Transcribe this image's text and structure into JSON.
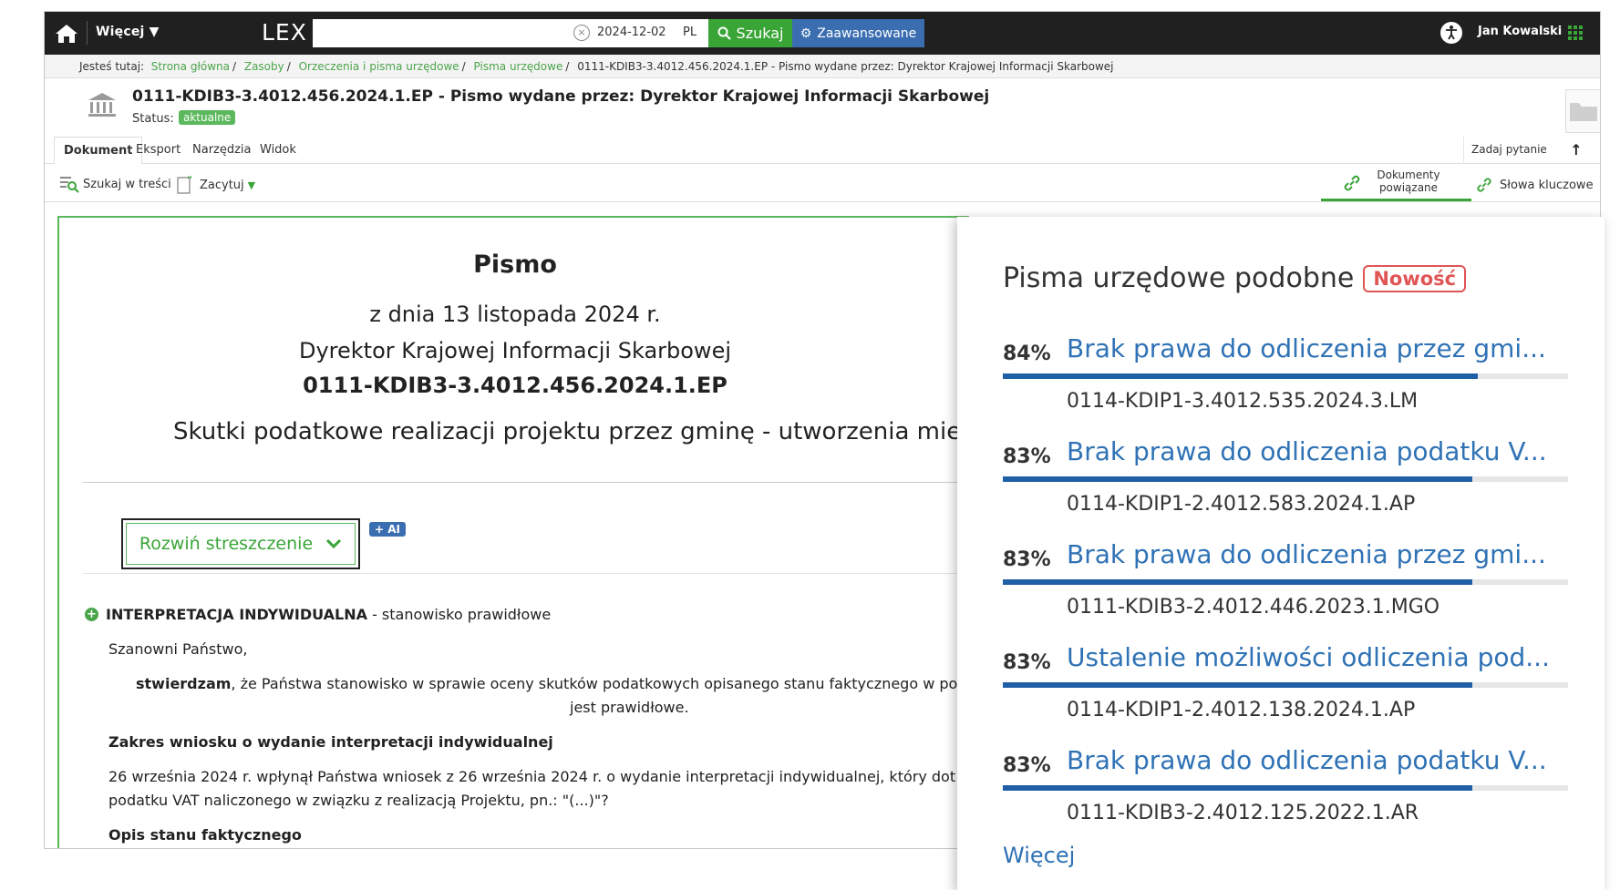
{
  "topbar": {
    "more_label": "Więcej",
    "logo": "LEX",
    "search_placeholder": "",
    "date": "2024-12-02",
    "lang": "PL",
    "search_label": "Szukaj",
    "advanced_label": "Zaawansowane",
    "user_name": "Jan Kowalski"
  },
  "breadcrumb": {
    "prefix": "Jesteś tutaj:",
    "items": [
      "Strona główna",
      "Zasoby",
      "Orzeczenia i pisma urzędowe",
      "Pisma urzędowe"
    ],
    "current": "0111-KDIB3-3.4012.456.2024.1.EP - Pismo wydane przez: Dyrektor Krajowej Informacji Skarbowej"
  },
  "document_header": {
    "title": "0111-KDIB3-3.4012.456.2024.1.EP - Pismo wydane przez: Dyrektor Krajowej Informacji Skarbowej",
    "status_label": "Status:",
    "status_value": "aktualne"
  },
  "tabs": [
    {
      "label": "Dokument",
      "active": true
    },
    {
      "label": "Eksport",
      "active": false
    },
    {
      "label": "Narzędzia",
      "active": false
    },
    {
      "label": "Widok",
      "active": false
    }
  ],
  "tabbar_right": {
    "ask_label": "Zadaj pytanie",
    "up_icon": "arrow-up-icon"
  },
  "toolbar": {
    "search_in_text": "Szukaj w treści",
    "cite": "Zacytuj",
    "related_docs": "Dokumenty powiązane",
    "keywords": "Słowa kluczowe"
  },
  "document": {
    "type": "Pismo",
    "date_line": "z dnia 13 listopada 2024 r.",
    "authority": "Dyrektor Krajowej Informacji Skarbowej",
    "signature": "0111-KDIB3-3.4012.456.2024.1.EP",
    "topic": "Skutki podatkowe realizacji projektu przez gminę - utworzenia miej",
    "expand_summary": "Rozwiń streszczenie",
    "ai_badge": "+ AI",
    "interpretation_bold": "INTERPRETACJA INDYWIDUALNA",
    "interpretation_rest": "- stanowisko prawidłowe",
    "greeting": "Szanowni Państwo,",
    "declaration_bold": "stwierdzam",
    "declaration_rest": ", że Państwa stanowisko w sprawie oceny skutków podatkowych opisanego stanu faktycznego w po",
    "declaration_line2": "jest prawidłowe.",
    "scope_heading": "Zakres wniosku o wydanie interpretacji indywidualnej",
    "body_line1": "26 września 2024 r. wpłynął Państwa wniosek z 26 września 2024 r. o wydanie interpretacji indywidualnej, który dot",
    "body_line2": "podatku VAT naliczonego w związku z realizacją Projektu, pn.: \"(...)\"?",
    "facts_heading": "Opis stanu faktycznego"
  },
  "similar": {
    "heading": "Pisma urzędowe podobne",
    "new_badge": "Nowość",
    "items": [
      {
        "percent": "84%",
        "fill": 0.84,
        "title": "Brak prawa do odliczenia przez gmi...",
        "signature": "0114-KDIP1-3.4012.535.2024.3.LM"
      },
      {
        "percent": "83%",
        "fill": 0.83,
        "title": "Brak prawa do odliczenia podatku V...",
        "signature": "0114-KDIP1-2.4012.583.2024.1.AP"
      },
      {
        "percent": "83%",
        "fill": 0.83,
        "title": "Brak prawa do odliczenia przez gmi...",
        "signature": "0111-KDIB3-2.4012.446.2023.1.MGO"
      },
      {
        "percent": "83%",
        "fill": 0.83,
        "title": "Ustalenie możliwości odliczenia pod...",
        "signature": "0114-KDIP1-2.4012.138.2024.1.AP"
      },
      {
        "percent": "83%",
        "fill": 0.83,
        "title": "Brak prawa do odliczenia podatku V...",
        "signature": "0111-KDIB3-2.4012.125.2022.1.AR"
      }
    ],
    "more_label": "Więcej"
  },
  "colors": {
    "topbar": "#202020",
    "search_green": "#3aa537",
    "advanced_blue": "#3b6eb1",
    "link_blue": "#2f72b5",
    "bar_blue": "#1f5fa5",
    "new_red": "#e05555"
  }
}
